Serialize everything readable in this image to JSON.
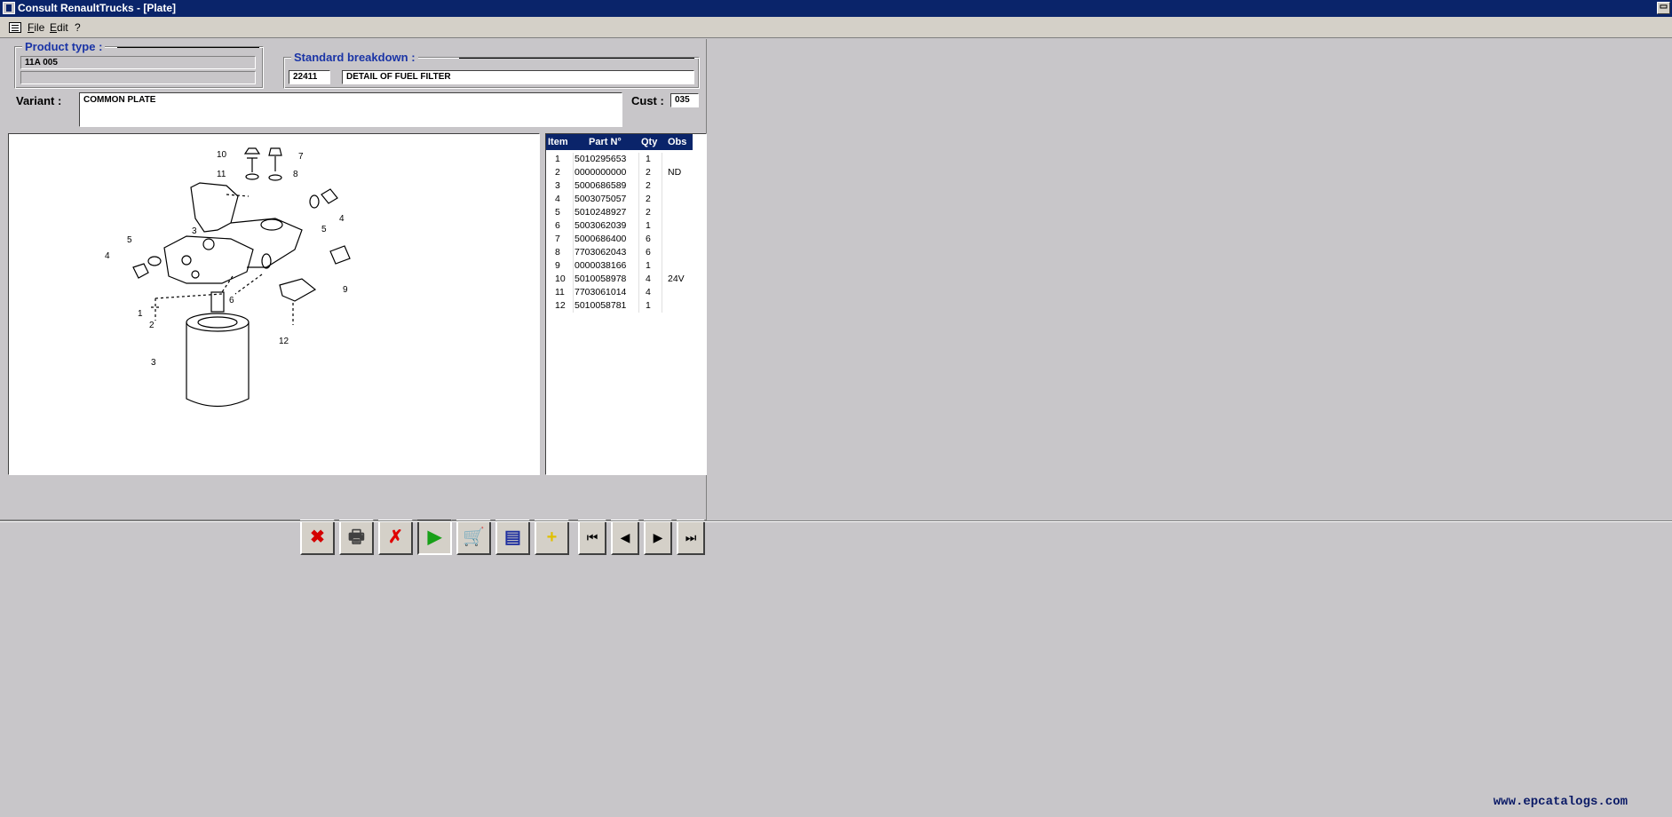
{
  "window": {
    "title": "Consult RenaultTrucks - [Plate]",
    "restore_glyph": "▭"
  },
  "menu": {
    "items": [
      "File",
      "Edit",
      "?"
    ]
  },
  "product_type": {
    "legend": "Product type :",
    "code": "11A 005",
    "description": ""
  },
  "standard_breakdown": {
    "legend": "Standard breakdown :",
    "code": "22411",
    "description": "DETAIL OF FUEL FILTER"
  },
  "variant": {
    "label": "Variant :",
    "value": "COMMON PLATE"
  },
  "cust": {
    "label": "Cust :",
    "value": "035"
  },
  "drawing": {
    "callouts": [
      "10",
      "7",
      "11",
      "8",
      "4",
      "5",
      "3",
      "5",
      "4",
      "9",
      "6",
      "1",
      "2",
      "12",
      "3"
    ]
  },
  "parts_table": {
    "headers": {
      "item": "Item",
      "part": "Part N°",
      "qty": "Qty",
      "obs": "Obs"
    },
    "rows": [
      {
        "item": "1",
        "part": "5010295653",
        "qty": "1",
        "obs": ""
      },
      {
        "item": "2",
        "part": "0000000000",
        "qty": "2",
        "obs": "ND"
      },
      {
        "item": "3",
        "part": "5000686589",
        "qty": "2",
        "obs": ""
      },
      {
        "item": "4",
        "part": "5003075057",
        "qty": "2",
        "obs": ""
      },
      {
        "item": "5",
        "part": "5010248927",
        "qty": "2",
        "obs": ""
      },
      {
        "item": "6",
        "part": "5003062039",
        "qty": "1",
        "obs": ""
      },
      {
        "item": "7",
        "part": "5000686400",
        "qty": "6",
        "obs": ""
      },
      {
        "item": "8",
        "part": "7703062043",
        "qty": "6",
        "obs": ""
      },
      {
        "item": "9",
        "part": "0000038166",
        "qty": "1",
        "obs": ""
      },
      {
        "item": "10",
        "part": "5010058978",
        "qty": "4",
        "obs": "24V"
      },
      {
        "item": "11",
        "part": "7703061014",
        "qty": "4",
        "obs": ""
      },
      {
        "item": "12",
        "part": "5010058781",
        "qty": "1",
        "obs": ""
      }
    ]
  },
  "toolbar": {
    "buttons": [
      {
        "name": "clear-selection-button",
        "icon": "crossed-out-x-icon",
        "glyph": "✖",
        "color": "#d40000"
      },
      {
        "name": "print-button",
        "icon": "printer-icon",
        "glyph": "🖶",
        "color": "#404040"
      },
      {
        "name": "cancel-button",
        "icon": "red-x-icon",
        "glyph": "✗",
        "color": "#e00000"
      },
      {
        "name": "exit-button",
        "icon": "door-exit-icon",
        "glyph": "▶",
        "color": "#18a018"
      },
      {
        "name": "cart-button",
        "icon": "shopping-cart-icon",
        "glyph": "🛒",
        "color": "#303030"
      },
      {
        "name": "save-button",
        "icon": "computer-save-icon",
        "glyph": "▤",
        "color": "#2030a0"
      },
      {
        "name": "add-button",
        "icon": "plus-icon",
        "glyph": "+",
        "color": "#e0c000"
      }
    ],
    "nav": [
      {
        "name": "first-button",
        "icon": "first-page-icon",
        "glyph": "⏮"
      },
      {
        "name": "previous-button",
        "icon": "previous-icon",
        "glyph": "◀"
      },
      {
        "name": "next-button",
        "icon": "next-icon",
        "glyph": "▶"
      },
      {
        "name": "last-button",
        "icon": "last-page-icon",
        "glyph": "⏭"
      }
    ]
  },
  "footer": {
    "watermark": "www.epcatalogs.com"
  }
}
